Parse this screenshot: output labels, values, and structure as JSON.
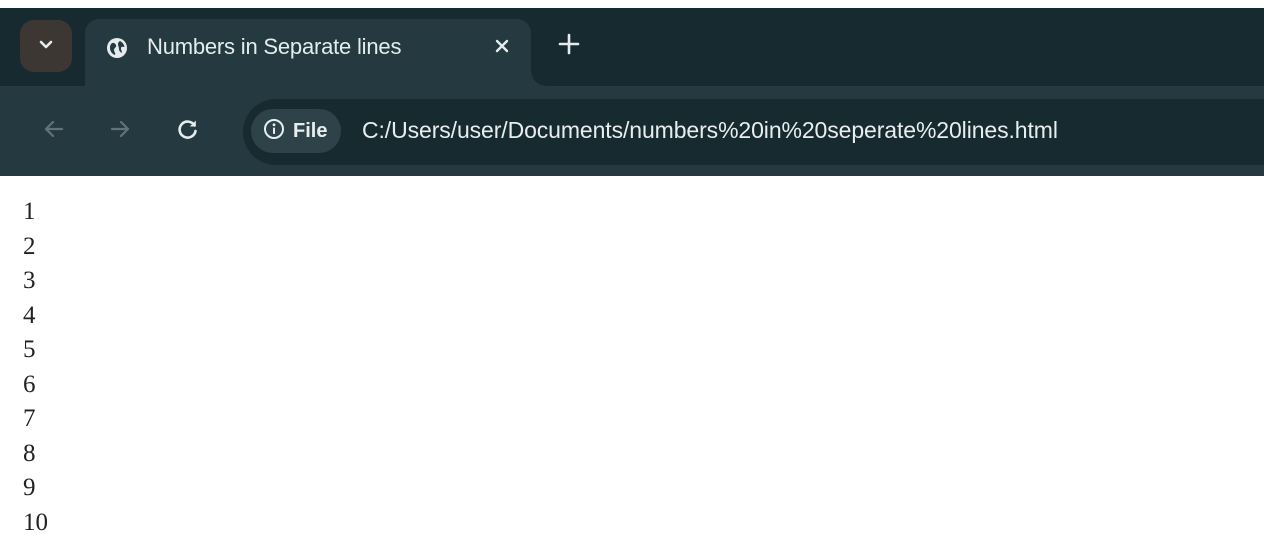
{
  "browser": {
    "tab": {
      "title": "Numbers in Separate lines",
      "favicon": "globe-icon",
      "close": "close-icon"
    },
    "tab_strip": {
      "search_tabs": "chevron-down-icon",
      "new_tab": "plus-icon"
    },
    "toolbar": {
      "back": "arrow-left-icon",
      "forward": "arrow-right-icon",
      "reload": "reload-icon",
      "site_info_icon": "info-icon",
      "site_info_label": "File",
      "url": "C:/Users/user/Documents/numbers%20in%20seperate%20lines.html"
    },
    "colors": {
      "tabbar_bg": "#172a2f",
      "toolbar_bg": "#243a40",
      "page_bg": "#ffffff"
    }
  },
  "page": {
    "numbers": [
      "1",
      "2",
      "3",
      "4",
      "5",
      "6",
      "7",
      "8",
      "9",
      "10"
    ]
  }
}
